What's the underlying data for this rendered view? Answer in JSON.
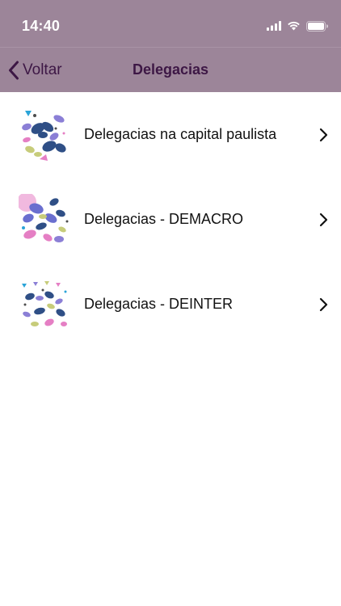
{
  "status": {
    "time": "14:40"
  },
  "nav": {
    "back_label": "Voltar",
    "title": "Delegacias"
  },
  "items": [
    {
      "label": "Delegacias na capital paulista",
      "icon": "butterflies-thumbnail"
    },
    {
      "label": "Delegacias - DEMACRO",
      "icon": "butterflies-thumbnail"
    },
    {
      "label": "Delegacias - DEINTER",
      "icon": "butterflies-thumbnail"
    }
  ],
  "colors": {
    "bar": "#9c8599",
    "nav_text": "#3d1745",
    "row_text": "#111111"
  }
}
